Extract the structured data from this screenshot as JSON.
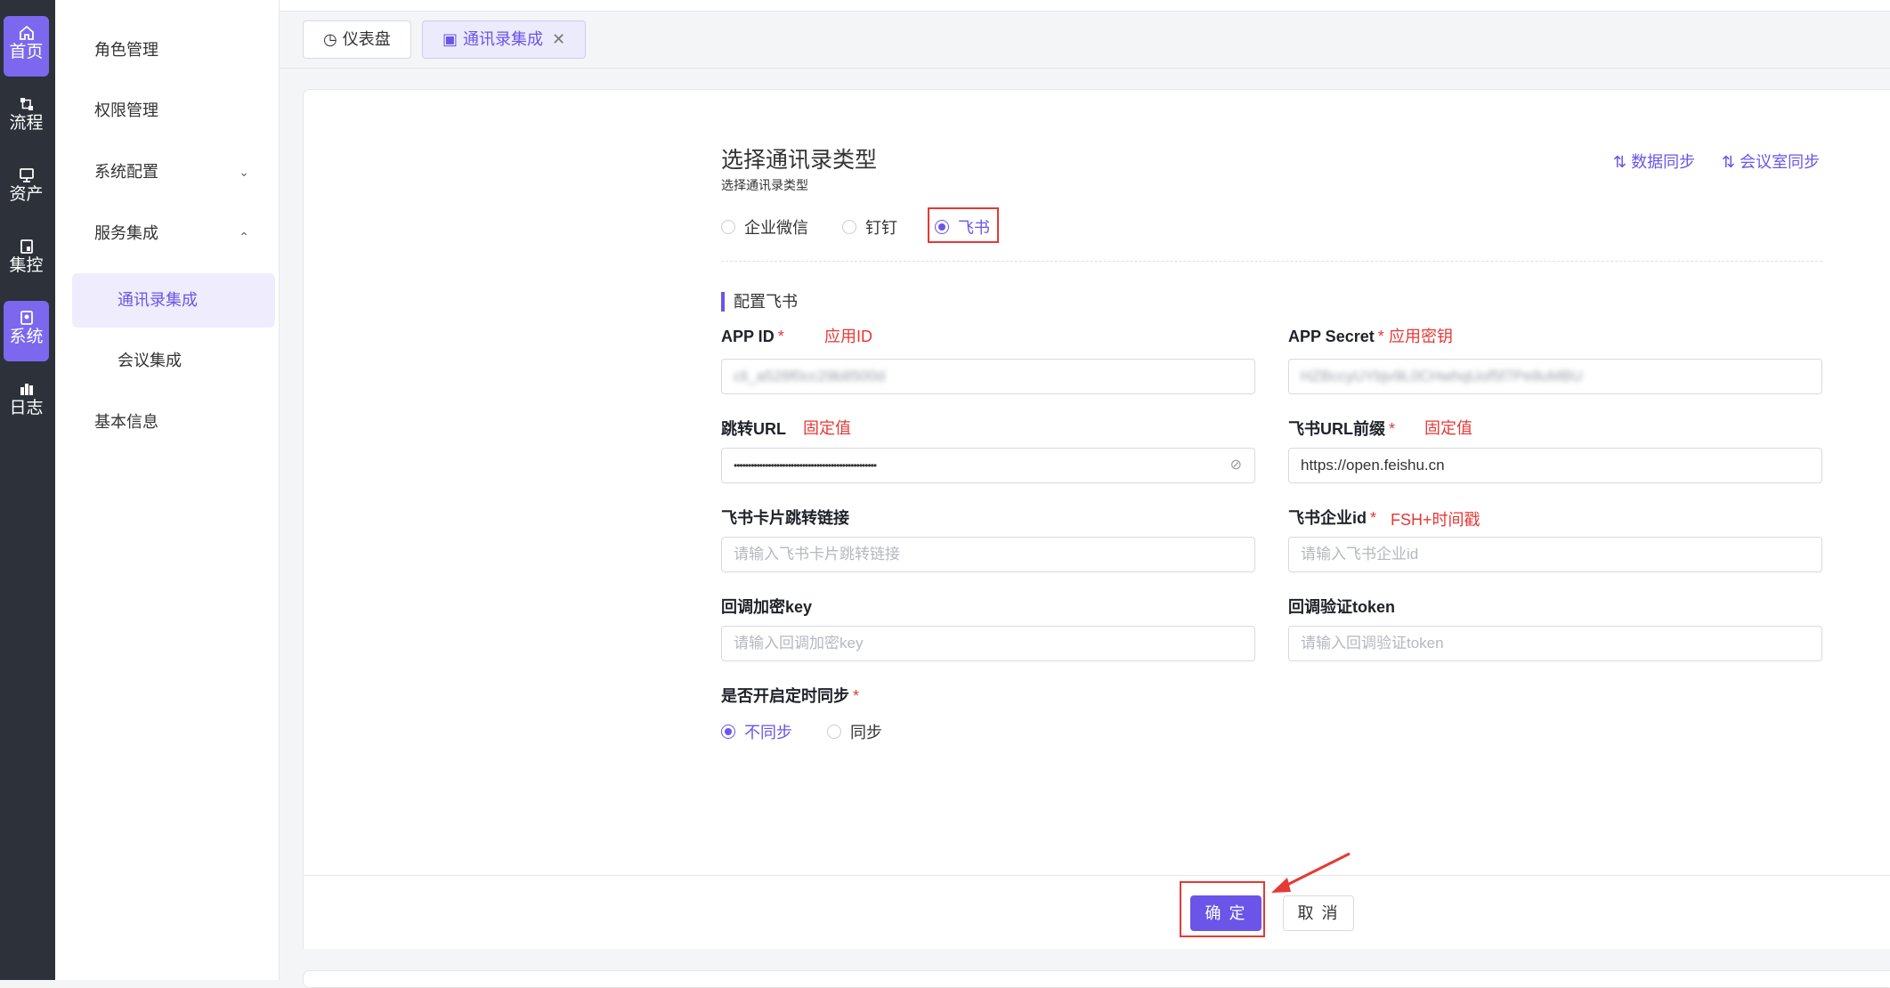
{
  "rail": {
    "items": [
      {
        "label": "首页",
        "icon": "home-icon"
      },
      {
        "label": "流程",
        "icon": "flow-icon"
      },
      {
        "label": "资产",
        "icon": "monitor-icon"
      },
      {
        "label": "集控",
        "icon": "device-icon"
      },
      {
        "label": "系统",
        "icon": "system-icon"
      },
      {
        "label": "日志",
        "icon": "log-icon"
      }
    ]
  },
  "sidebar": {
    "items": [
      {
        "label": "角色管理"
      },
      {
        "label": "权限管理"
      },
      {
        "label": "系统配置"
      },
      {
        "label": "服务集成"
      }
    ],
    "sub_items": [
      {
        "label": "通讯录集成"
      },
      {
        "label": "会议集成"
      }
    ],
    "bottom_item": {
      "label": "基本信息"
    }
  },
  "tabs": [
    {
      "label": "仪表盘"
    },
    {
      "label": "通讯录集成"
    }
  ],
  "header": {
    "title": "选择通讯录类型",
    "subtitle": "选择通讯录类型",
    "sync_data": "数据同步",
    "sync_rooms": "会议室同步"
  },
  "type_options": [
    {
      "label": "企业微信"
    },
    {
      "label": "钉钉"
    },
    {
      "label": "飞书"
    }
  ],
  "section_title": "配置飞书",
  "fields": {
    "app_id": {
      "label": "APP ID",
      "note": "应用ID",
      "value": "cli_a528f0cc29b8500d"
    },
    "app_secret": {
      "label": "APP Secret",
      "note": "应用密钥",
      "value": "HZBccyUYbjv9L0CHwhqUof5f7Pe8uMBU"
    },
    "redirect_url": {
      "label": "跳转URL",
      "note": "固定值",
      "value": "••••••••••••••••••••••••••••••••••••••••••••••••••"
    },
    "feishu_url_prefix": {
      "label": "飞书URL前缀",
      "note": "固定值",
      "value": "https://open.feishu.cn"
    },
    "card_link": {
      "label": "飞书卡片跳转链接",
      "placeholder": "请输入飞书卡片跳转链接"
    },
    "enterprise_id": {
      "label": "飞书企业id",
      "note": "FSH+时间戳",
      "placeholder": "请输入飞书企业id"
    },
    "callback_key": {
      "label": "回调加密key",
      "placeholder": "请输入回调加密key"
    },
    "callback_token": {
      "label": "回调验证token",
      "placeholder": "请输入回调验证token"
    }
  },
  "timed_sync": {
    "label": "是否开启定时同步",
    "options": [
      {
        "label": "不同步"
      },
      {
        "label": "同步"
      }
    ]
  },
  "buttons": {
    "confirm": "确 定",
    "cancel": "取 消"
  },
  "colors": {
    "accent": "#6a55e8",
    "annotation": "#e53935",
    "rail": "#2d3139"
  }
}
